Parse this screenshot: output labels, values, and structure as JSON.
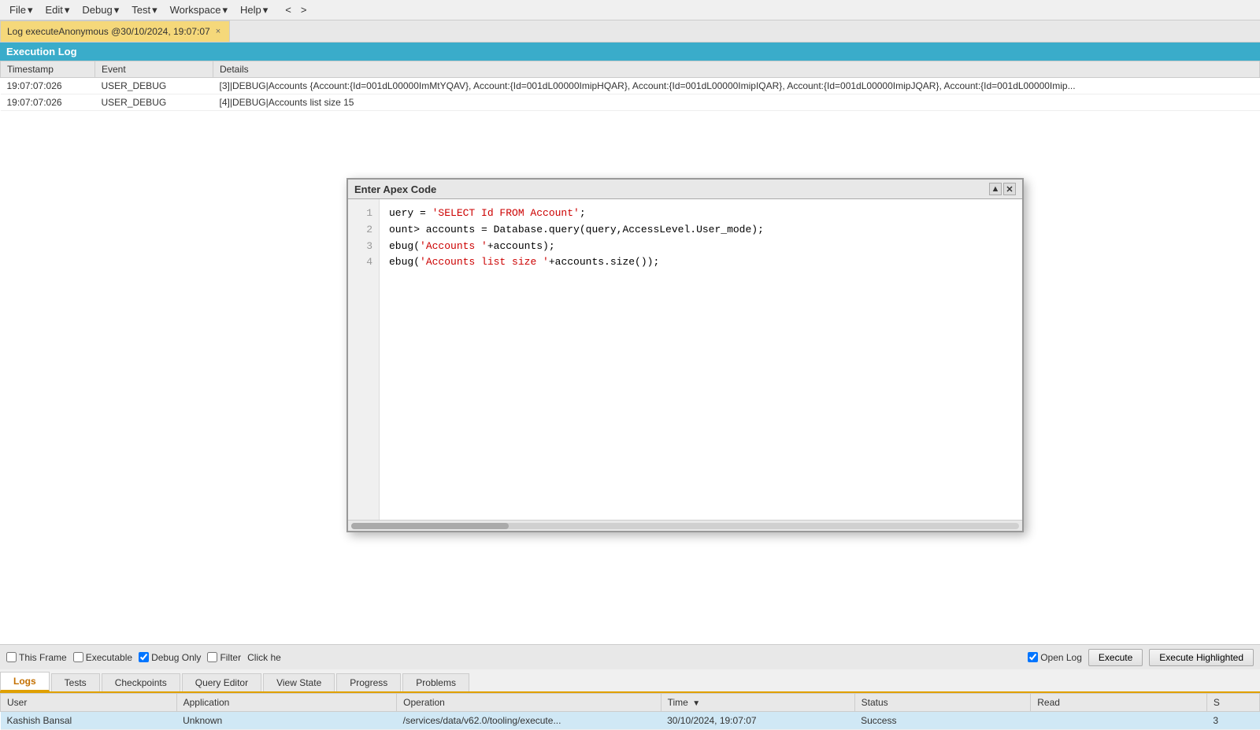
{
  "menubar": {
    "items": [
      {
        "label": "File",
        "hasArrow": true
      },
      {
        "label": "Edit",
        "hasArrow": true
      },
      {
        "label": "Debug",
        "hasArrow": true
      },
      {
        "label": "Test",
        "hasArrow": true
      },
      {
        "label": "Workspace",
        "hasArrow": true
      },
      {
        "label": "Help",
        "hasArrow": true
      }
    ],
    "nav_back": "<",
    "nav_forward": ">"
  },
  "doc_tab": {
    "label": "Log executeAnonymous @30/10/2024, 19:07:07",
    "close": "×"
  },
  "exec_log": {
    "header": "Execution Log",
    "columns": [
      "Timestamp",
      "Event",
      "Details"
    ],
    "rows": [
      {
        "timestamp": "19:07:07:026",
        "event": "USER_DEBUG",
        "details": "[3]|DEBUG|Accounts {Account:{Id=001dL00000ImMtYQAV}, Account:{Id=001dL00000ImipHQAR}, Account:{Id=001dL00000ImipIQAR}, Account:{Id=001dL00000ImipJQAR}, Account:{Id=001dL00000Imip..."
      },
      {
        "timestamp": "19:07:07:026",
        "event": "USER_DEBUG",
        "details": "[4]|DEBUG|Accounts list size 15"
      }
    ]
  },
  "bottom_toolbar": {
    "this_frame_label": "This Frame",
    "executable_label": "Executable",
    "debug_only_label": "Debug Only",
    "filter_label": "Filter",
    "click_here_text": "Click he",
    "open_log_label": "Open Log",
    "execute_label": "Execute",
    "execute_highlighted_label": "Execute Highlighted"
  },
  "bottom_tabs": [
    {
      "label": "Logs",
      "active": true
    },
    {
      "label": "Tests",
      "active": false
    },
    {
      "label": "Checkpoints",
      "active": false
    },
    {
      "label": "Query Editor",
      "active": false
    },
    {
      "label": "View State",
      "active": false
    },
    {
      "label": "Progress",
      "active": false
    },
    {
      "label": "Problems",
      "active": false
    }
  ],
  "logs_table": {
    "columns": [
      {
        "label": "User"
      },
      {
        "label": "Application"
      },
      {
        "label": "Operation"
      },
      {
        "label": "Time",
        "sort": "▼"
      },
      {
        "label": "Status"
      },
      {
        "label": "Read"
      },
      {
        "label": "S"
      }
    ],
    "rows": [
      {
        "user": "Kashish Bansal",
        "application": "Unknown",
        "operation": "/services/data/v62.0/tooling/execute...",
        "time": "30/10/2024, 19:07:07",
        "status": "Success",
        "read": "",
        "s": "3",
        "selected": true
      }
    ]
  },
  "dialog": {
    "title": "Enter Apex Code",
    "minimize": "▲",
    "close": "✕",
    "code_lines": [
      {
        "num": "1",
        "parts": [
          {
            "text": "uery = ",
            "type": "black"
          },
          {
            "text": "'SELECT Id FROM Account'",
            "type": "string"
          },
          {
            "text": ";",
            "type": "black"
          }
        ]
      },
      {
        "num": "2",
        "parts": [
          {
            "text": "ount> accounts = Database.query(query,AccessLevel.User_mode);",
            "type": "black"
          }
        ]
      },
      {
        "num": "3",
        "parts": [
          {
            "text": "ebug(",
            "type": "black"
          },
          {
            "text": "'Accounts '",
            "type": "string"
          },
          {
            "text": "+accounts);",
            "type": "black"
          }
        ]
      },
      {
        "num": "4",
        "parts": [
          {
            "text": "ebug(",
            "type": "black"
          },
          {
            "text": "'Accounts list size '",
            "type": "string"
          },
          {
            "text": "+accounts.size());",
            "type": "black"
          }
        ]
      }
    ]
  }
}
